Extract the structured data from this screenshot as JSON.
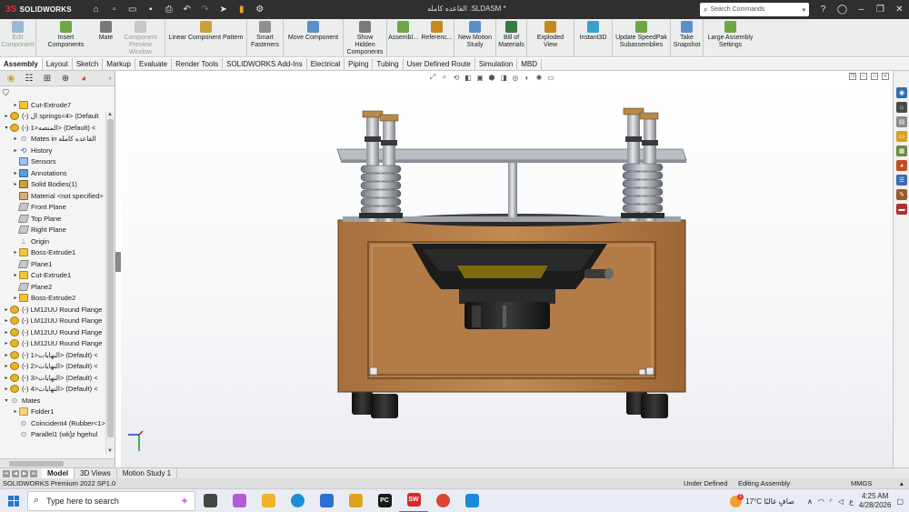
{
  "titlebar": {
    "app_name": "SOLIDWORKS",
    "doc_title": "القاعده كامله .SLDASM *",
    "search_placeholder": "Search Commands",
    "quick_icons": [
      "home-icon",
      "new-document-icon",
      "open-icon",
      "save-icon",
      "print-icon",
      "undo-icon",
      "redo-icon",
      "select-icon",
      "rebuild-icon",
      "options-icon"
    ]
  },
  "command_manager": [
    {
      "label": "Edit Component",
      "disabled": true,
      "icon": "edit-component-icon",
      "color": "#9bb7d6"
    },
    {
      "label": "Insert Components",
      "disabled": false,
      "icon": "insert-components-icon",
      "color": "#6ea646"
    },
    {
      "label": "Mate",
      "disabled": false,
      "icon": "mate-icon",
      "color": "#7a7a7a"
    },
    {
      "label": "Component Preview Window",
      "disabled": true,
      "icon": "preview-window-icon",
      "color": "#c8c8c8"
    },
    {
      "label": "Linear Component Pattern",
      "disabled": false,
      "icon": "linear-pattern-icon",
      "color": "#c9a13a"
    },
    {
      "label": "Smart Fasteners",
      "disabled": false,
      "icon": "smart-fasteners-icon",
      "color": "#8f8f8f"
    },
    {
      "label": "Move Component",
      "disabled": false,
      "icon": "move-component-icon",
      "color": "#5a8fc9"
    },
    {
      "label": "Show Hidden Components",
      "disabled": false,
      "icon": "show-hidden-icon",
      "color": "#7a7a7a"
    },
    {
      "label": "Assembl...",
      "disabled": false,
      "icon": "assembly-features-icon",
      "color": "#6ea646"
    },
    {
      "label": "Referenc...",
      "disabled": false,
      "icon": "reference-geometry-icon",
      "color": "#c48a1a"
    },
    {
      "label": "New Motion Study",
      "disabled": false,
      "icon": "motion-study-icon",
      "color": "#5a8fc9"
    },
    {
      "label": "Bill of Materials",
      "disabled": false,
      "icon": "bom-icon",
      "color": "#3a7a3a"
    },
    {
      "label": "Exploded View",
      "disabled": false,
      "icon": "exploded-view-icon",
      "color": "#c48a1a"
    },
    {
      "label": "Instant3D",
      "disabled": false,
      "icon": "instant3d-icon",
      "color": "#3aa0c9"
    },
    {
      "label": "Update SpeedPak Subassemblies",
      "disabled": false,
      "icon": "speedpak-icon",
      "color": "#6ea646"
    },
    {
      "label": "Take Snapshot",
      "disabled": false,
      "icon": "snapshot-icon",
      "color": "#5a8fc9"
    },
    {
      "label": "Large Assembly Settings",
      "disabled": false,
      "icon": "large-assembly-icon",
      "color": "#6ea646"
    }
  ],
  "tabs": [
    "Assembly",
    "Layout",
    "Sketch",
    "Markup",
    "Evaluate",
    "Render Tools",
    "SOLIDWORKS Add-Ins",
    "Electrical",
    "Piping",
    "Tubing",
    "User Defined Route",
    "Simulation",
    "MBD"
  ],
  "active_tab": "Assembly",
  "feature_tree": [
    {
      "label": "Cut-Extrude7",
      "icon": "feat",
      "indent": 1,
      "twisty": "▸"
    },
    {
      "label": "(-) ال springs<4> (Default",
      "icon": "comp",
      "indent": 0,
      "twisty": "▸"
    },
    {
      "label": "(-) المنصه<1> (Default) <",
      "icon": "comp",
      "indent": 0,
      "twisty": "▾"
    },
    {
      "label": "Mates in القاعده كامله",
      "icon": "mate",
      "indent": 1,
      "twisty": "▸"
    },
    {
      "label": "History",
      "icon": "hist",
      "indent": 1,
      "twisty": "▸"
    },
    {
      "label": "Sensors",
      "icon": "sens",
      "indent": 1,
      "twisty": ""
    },
    {
      "label": "Annotations",
      "icon": "annot",
      "indent": 1,
      "twisty": "▸"
    },
    {
      "label": "Solid Bodies(1)",
      "icon": "solid",
      "indent": 1,
      "twisty": "▸"
    },
    {
      "label": "Material <not specified>",
      "icon": "mat",
      "indent": 1,
      "twisty": ""
    },
    {
      "label": "Front Plane",
      "icon": "plane",
      "indent": 1,
      "twisty": ""
    },
    {
      "label": "Top Plane",
      "icon": "plane",
      "indent": 1,
      "twisty": ""
    },
    {
      "label": "Right Plane",
      "icon": "plane",
      "indent": 1,
      "twisty": ""
    },
    {
      "label": "Origin",
      "icon": "orig",
      "indent": 1,
      "twisty": ""
    },
    {
      "label": "Boss-Extrude1",
      "icon": "feat",
      "indent": 1,
      "twisty": "▸"
    },
    {
      "label": "Plane1",
      "icon": "plane",
      "indent": 1,
      "twisty": ""
    },
    {
      "label": "Cut-Extrude1",
      "icon": "feat",
      "indent": 1,
      "twisty": "▸"
    },
    {
      "label": "Plane2",
      "icon": "plane",
      "indent": 1,
      "twisty": ""
    },
    {
      "label": "Boss-Extrude2",
      "icon": "feat",
      "indent": 1,
      "twisty": "▸"
    },
    {
      "label": "(-) LM12UU Round Flange",
      "icon": "comp",
      "indent": 0,
      "twisty": "▸"
    },
    {
      "label": "(-) LM12UU Round Flange",
      "icon": "comp",
      "indent": 0,
      "twisty": "▸"
    },
    {
      "label": "(-) LM12UU Round Flange",
      "icon": "comp",
      "indent": 0,
      "twisty": "▸"
    },
    {
      "label": "(-) LM12UU Round Flange",
      "icon": "comp",
      "indent": 0,
      "twisty": "▸"
    },
    {
      "label": "(-) النهايات<1> (Default) <",
      "icon": "comp",
      "indent": 0,
      "twisty": "▸"
    },
    {
      "label": "(-) النهايات<2> (Default) <",
      "icon": "comp",
      "indent": 0,
      "twisty": "▸"
    },
    {
      "label": "(-) النهايات<3> (Default) <",
      "icon": "comp",
      "indent": 0,
      "twisty": "▸"
    },
    {
      "label": "(-) النهايات<4> (Default) <",
      "icon": "comp",
      "indent": 0,
      "twisty": "▸"
    },
    {
      "label": "Mates",
      "icon": "mate",
      "indent": 0,
      "twisty": "▾"
    },
    {
      "label": "Folder1",
      "icon": "folder",
      "indent": 1,
      "twisty": "▸"
    },
    {
      "label": "Coincident4 (Rubber<1>",
      "icon": "mate",
      "indent": 1,
      "twisty": ""
    },
    {
      "label": "Parallel1 (wk]z hgehul",
      "icon": "mate",
      "indent": 1,
      "twisty": ""
    }
  ],
  "bottom_tabs": [
    "Model",
    "3D Views",
    "Motion Study 1"
  ],
  "active_bottom_tab": "Model",
  "status": {
    "product": "SOLIDWORKS Premium 2022 SP1.0",
    "definition": "Under Defined",
    "mode": "Editing Assembly",
    "units": "MMGS"
  },
  "taskbar": {
    "search_placeholder": "Type here to search",
    "apps": [
      {
        "name": "task-view-icon",
        "label": "",
        "color": "#444"
      },
      {
        "name": "copilot-icon",
        "label": "",
        "color": "#b85ad8"
      },
      {
        "name": "file-explorer-icon",
        "label": "",
        "color": "#f0b429"
      },
      {
        "name": "edge-icon",
        "label": "",
        "color": "#1b8fd6"
      },
      {
        "name": "store-icon",
        "label": "",
        "color": "#2b6fd0"
      },
      {
        "name": "notes-icon",
        "label": "",
        "color": "#e0a020"
      },
      {
        "name": "pycharm-icon",
        "label": "PC",
        "color": "#1a1a1a"
      },
      {
        "name": "solidworks-taskbar-icon",
        "label": "SW",
        "color": "#d42a2a"
      },
      {
        "name": "chrome-icon",
        "label": "",
        "color": "#db4437"
      },
      {
        "name": "photos-icon",
        "label": "",
        "color": "#1a8ad8"
      }
    ],
    "weather": "17°C صافٍ غالبًا",
    "weather_badge": "1",
    "lang": "ع",
    "time": "4:25 AM",
    "date": "4/28/2026"
  }
}
